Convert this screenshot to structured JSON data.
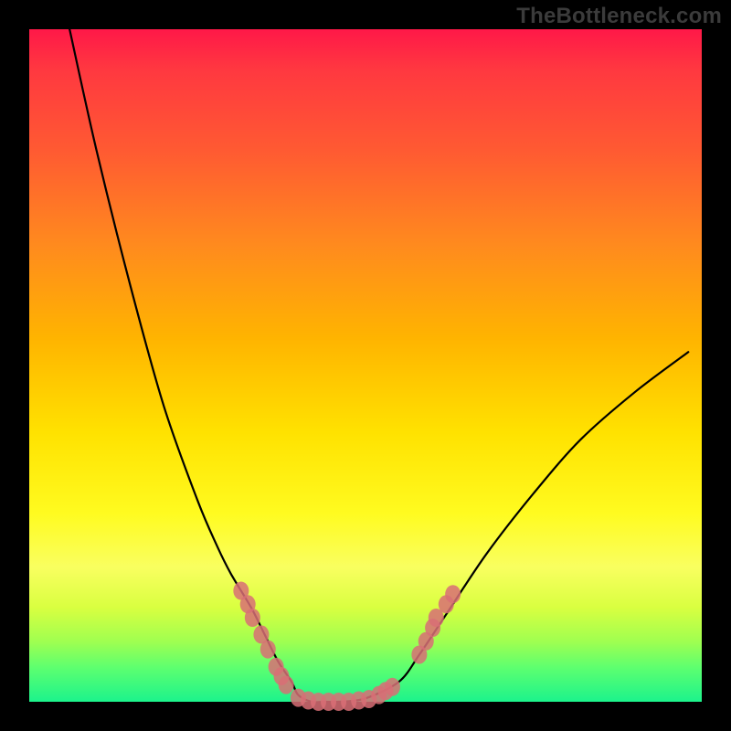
{
  "watermark": "TheBottleneck.com",
  "chart_data": {
    "type": "line",
    "title": "",
    "xlabel": "",
    "ylabel": "",
    "xlim": [
      0,
      100
    ],
    "ylim": [
      0,
      100
    ],
    "grid": false,
    "legend": false,
    "series": [
      {
        "name": "curve",
        "color": "#000000",
        "x": [
          6,
          10,
          15,
          20,
          25,
          28,
          30,
          33,
          35,
          37,
          39,
          40,
          42,
          44,
          46,
          50,
          55,
          58,
          62,
          68,
          75,
          82,
          90,
          98
        ],
        "values": [
          100,
          82,
          62,
          44,
          30,
          23,
          19,
          14,
          10,
          6,
          3,
          1,
          0,
          0,
          0,
          0.5,
          3,
          7,
          13,
          22,
          31,
          39,
          46,
          52
        ]
      }
    ],
    "annotations": {
      "marker_groups": [
        {
          "name": "left-cluster",
          "color": "#d86f75",
          "points": [
            {
              "x": 31.5,
              "y": 16.5
            },
            {
              "x": 32.5,
              "y": 14.5
            },
            {
              "x": 33.2,
              "y": 12.5
            },
            {
              "x": 34.5,
              "y": 10.0
            },
            {
              "x": 35.5,
              "y": 7.8
            },
            {
              "x": 36.7,
              "y": 5.2
            },
            {
              "x": 37.5,
              "y": 3.8
            },
            {
              "x": 38.2,
              "y": 2.5
            }
          ]
        },
        {
          "name": "bottom-cluster",
          "color": "#d86f75",
          "points": [
            {
              "x": 40.0,
              "y": 0.6
            },
            {
              "x": 41.5,
              "y": 0.2
            },
            {
              "x": 43.0,
              "y": 0.0
            },
            {
              "x": 44.5,
              "y": 0.0
            },
            {
              "x": 46.0,
              "y": 0.0
            },
            {
              "x": 47.5,
              "y": 0.0
            },
            {
              "x": 49.0,
              "y": 0.2
            },
            {
              "x": 50.5,
              "y": 0.4
            },
            {
              "x": 52.0,
              "y": 1.0
            },
            {
              "x": 53.0,
              "y": 1.6
            },
            {
              "x": 54.0,
              "y": 2.2
            }
          ]
        },
        {
          "name": "right-cluster",
          "color": "#d86f75",
          "points": [
            {
              "x": 58.0,
              "y": 7.0
            },
            {
              "x": 59.0,
              "y": 9.0
            },
            {
              "x": 60.0,
              "y": 11.0
            },
            {
              "x": 60.5,
              "y": 12.5
            },
            {
              "x": 62.0,
              "y": 14.5
            },
            {
              "x": 63.0,
              "y": 16.0
            }
          ]
        }
      ]
    }
  }
}
